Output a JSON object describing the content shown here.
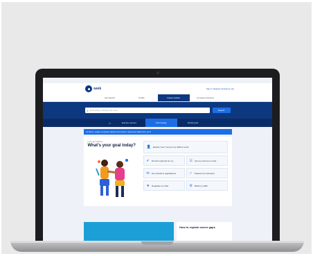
{
  "utility_links": [
    "",
    "",
    "",
    ""
  ],
  "brand": {
    "name": "seek"
  },
  "account": {
    "signin_label": "Sign in  Register  Employer site"
  },
  "main_nav": [
    {
      "label": "Job Search",
      "active": false
    },
    {
      "label": "Profile",
      "active": false
    },
    {
      "label": "Career Advice",
      "active": true
    },
    {
      "label": "Company Reviews",
      "active": false
    }
  ],
  "search": {
    "placeholder": "Find advice, articles and more",
    "button_label": "Search"
  },
  "sub_nav": [
    {
      "label": "Explore careers",
      "active": false
    },
    {
      "label": "Job hunting",
      "active": true
    },
    {
      "label": "Working life",
      "active": false
    }
  ],
  "banner": {
    "text": "Hi there, ready to explore advice and career resources tailored to you?"
  },
  "goal": {
    "eyebrow": "Let's get started",
    "title": "What's your goal today?"
  },
  "cards": [
    {
      "icon": "👤",
      "label": "Explore how I can put my skills to work"
    },
    {
      "icon": "✔",
      "label": "Find the right job for me"
    },
    {
      "icon": "☷",
      "label": "Get my résumé in order"
    },
    {
      "icon": "✉",
      "label": "Get noticed in applications"
    },
    {
      "icon": "✓",
      "label": "Prepare for interviews"
    },
    {
      "icon": "★",
      "label": "Negotiate my offer"
    },
    {
      "icon": "⚙",
      "label": "Build my skills"
    }
  ],
  "article": {
    "title": "How to explain career gaps"
  },
  "colors": {
    "brand_dark": "#0d3880",
    "accent": "#1c6ee6",
    "subnav": "#0a2c66"
  }
}
